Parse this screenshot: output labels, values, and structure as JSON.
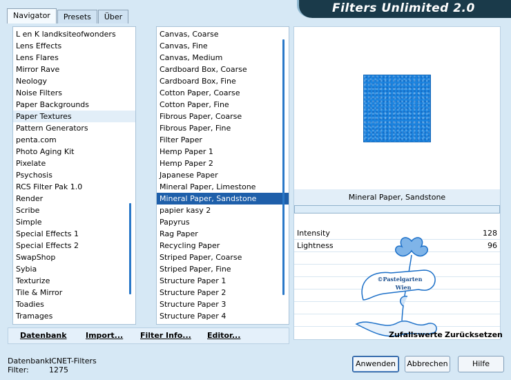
{
  "app": {
    "title": "Filters Unlimited 2.0"
  },
  "tabs": [
    {
      "label": "Navigator"
    },
    {
      "label": "Presets"
    },
    {
      "label": "Über"
    }
  ],
  "categories": [
    "L en K landksiteofwonders",
    "Lens Effects",
    "Lens Flares",
    "Mirror Rave",
    "Neology",
    "Noise Filters",
    "Paper Backgrounds",
    "Paper Textures",
    "Pattern Generators",
    "penta.com",
    "Photo Aging Kit",
    "Pixelate",
    "Psychosis",
    "RCS Filter Pak 1.0",
    "Render",
    "Scribe",
    "Simple",
    "Special Effects 1",
    "Special Effects 2",
    "SwapShop",
    "Sybia",
    "Texturize",
    "Tile & Mirror",
    "Toadies",
    "Tramages"
  ],
  "filters": [
    "Canvas, Coarse",
    "Canvas, Fine",
    "Canvas, Medium",
    "Cardboard Box, Coarse",
    "Cardboard Box, Fine",
    "Cotton Paper, Coarse",
    "Cotton Paper, Fine",
    "Fibrous Paper, Coarse",
    "Fibrous Paper, Fine",
    "Filter Paper",
    "Hemp Paper 1",
    "Hemp Paper 2",
    "Japanese Paper",
    "Mineral Paper, Limestone",
    "Mineral Paper, Sandstone",
    "papier kasy 2",
    "Papyrus",
    "Rag Paper",
    "Recycling Paper",
    "Striped Paper, Coarse",
    "Striped Paper, Fine",
    "Structure Paper 1",
    "Structure Paper 2",
    "Structure Paper 3",
    "Structure Paper 4"
  ],
  "preview": {
    "filter_name": "Mineral Paper, Sandstone",
    "controls": [
      {
        "label": "Intensity",
        "value": "128"
      },
      {
        "label": "Lightness",
        "value": "96"
      }
    ]
  },
  "logo": {
    "line1": "©Pastelgarten",
    "line2": "Wien"
  },
  "bottom_links": {
    "datenbank": "Datenbank",
    "import": "Import...",
    "filter_info": "Filter Info...",
    "editor": "Editor..."
  },
  "right_links": {
    "random": "Zufallswerte",
    "reset": "Zurücksetzen"
  },
  "status": {
    "db_label": "Datenbank:",
    "db_value": "ICNET-Filters",
    "filter_label": "Filter:",
    "filter_value": "1275"
  },
  "buttons": {
    "apply": "Anwenden",
    "cancel": "Abbrechen",
    "help": "Hilfe"
  },
  "colors": {
    "accent": "#1e5faa",
    "banner_bg": "#1a3a4a",
    "preview": "#1b84e0"
  }
}
